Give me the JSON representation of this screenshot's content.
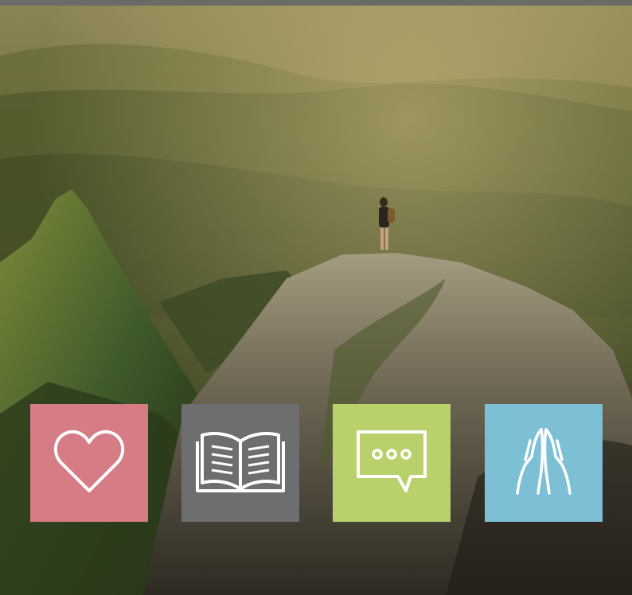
{
  "tiles": [
    {
      "icon": "heart-icon",
      "color": "#d67c86"
    },
    {
      "icon": "open-book-icon",
      "color": "#6d6e70"
    },
    {
      "icon": "chat-bubble-icon",
      "color": "#b9d16a"
    },
    {
      "icon": "praying-hands-icon",
      "color": "#7dc0d5"
    }
  ],
  "colors": {
    "top_strip": "#6a6a66"
  }
}
